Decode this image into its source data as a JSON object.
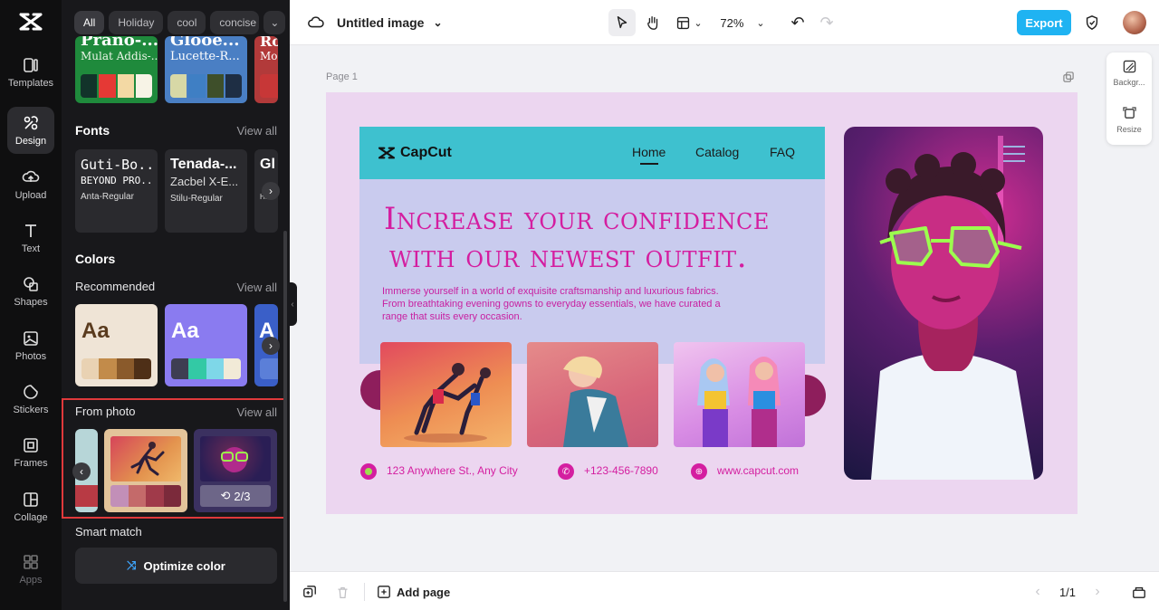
{
  "rail": {
    "items": [
      {
        "label": "Templates",
        "icon": "templates-icon"
      },
      {
        "label": "Design",
        "icon": "design-icon",
        "active": true
      },
      {
        "label": "Upload",
        "icon": "upload-icon"
      },
      {
        "label": "Text",
        "icon": "text-icon"
      },
      {
        "label": "Shapes",
        "icon": "shapes-icon"
      },
      {
        "label": "Photos",
        "icon": "photos-icon"
      },
      {
        "label": "Stickers",
        "icon": "stickers-icon"
      },
      {
        "label": "Frames",
        "icon": "frames-icon"
      },
      {
        "label": "Collage",
        "icon": "collage-icon"
      },
      {
        "label": "Apps",
        "icon": "apps-icon"
      }
    ]
  },
  "panel": {
    "chips": [
      "All",
      "Holiday",
      "cool",
      "concise"
    ],
    "top_cards": [
      {
        "name": "Prano-...",
        "font": "Mulat Addis-...",
        "bg": "#1f8a3c",
        "swatches": [
          "#12332a",
          "#e53935",
          "#f3d9a4",
          "#f7f3e6"
        ]
      },
      {
        "name": "Glooe...",
        "font": "Lucette-R...",
        "bg": "#4a7fc4",
        "swatches": [
          "#d7d8a6",
          "#3f7fc4",
          "#3e4f2a",
          "#1e2e44"
        ]
      },
      {
        "name": "Ro",
        "font": "Mo",
        "bg": "#b23a3a",
        "swatches": [
          "#c73737",
          "#ffffff"
        ]
      }
    ],
    "fonts": {
      "title": "Fonts",
      "view_all": "View all",
      "cards": [
        {
          "line1": "Guti-Bo...",
          "line2": "BEYOND PRO...",
          "line3": "Anta-Regular"
        },
        {
          "line1": "Tenada-...",
          "line2": "Zacbel X-E...",
          "line3": "Stilu-Regular"
        },
        {
          "line1": "Gl",
          "line2": "",
          "line3": "Ham"
        }
      ]
    },
    "colors": {
      "title": "Colors",
      "recommended": "Recommended",
      "view_all": "View all",
      "cards": [
        {
          "label": "Aa",
          "bg": "#efe4d6",
          "fg": "#5a3b1e",
          "swatches": [
            "#e9d2b3",
            "#c28b4a",
            "#8a5a2b",
            "#4e2f17"
          ]
        },
        {
          "label": "Aa",
          "bg": "#8a7bf0",
          "fg": "#ffffff",
          "swatches": [
            "#3e3e52",
            "#33c9a5",
            "#7ed7e8",
            "#f1ead7"
          ]
        },
        {
          "label": "A",
          "bg": "#3a5fc8",
          "fg": "#ffffff",
          "swatches": [
            "#5b7fd8"
          ]
        }
      ]
    },
    "from_photo": {
      "title": "From photo",
      "view_all": "View all",
      "counter": "2/3",
      "card_swatches": [
        [
          "#c28fb8",
          "#c46a6a",
          "#a03a4a",
          "#7b2a3b"
        ]
      ]
    },
    "smart_match": {
      "title": "Smart match",
      "button": "Optimize color"
    }
  },
  "topbar": {
    "title": "Untitled image",
    "zoom": "72%",
    "export": "Export"
  },
  "canvas": {
    "page_label": "Page 1",
    "brand": "CapCut",
    "nav": [
      "Home",
      "Catalog",
      "FAQ"
    ],
    "headline1": "Increase your confidence",
    "headline2": "with our newest outfit.",
    "body": "Immerse yourself in a world of exquisite craftsmanship and luxurious fabrics. From breathtaking evening gowns to everyday essentials, we have curated a range that suits every occasion.",
    "address": "123 Anywhere St., Any City",
    "phone": "+123-456-7890",
    "website": "www.capcut.com",
    "accent": "#d41ea0"
  },
  "right_tools": [
    {
      "label": "Backgr...",
      "icon": "background-icon"
    },
    {
      "label": "Resize",
      "icon": "resize-icon"
    }
  ],
  "bottombar": {
    "add_page": "Add page",
    "page_count": "1/1"
  }
}
